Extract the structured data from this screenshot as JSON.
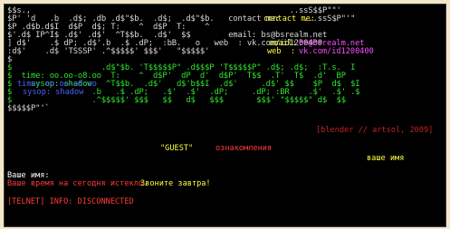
{
  "art": [
    {
      "color": "c-white",
      "text": "$$s.,                                                       ..ssS$$P\"\"'"
    },
    {
      "color": "c-white",
      "text": "$P' 'd   .b  .d$; .db .d$\"$b.  .d$;  .d$\"$b.   contact me:     ...ssS$P\"'\""
    },
    {
      "color": "c-white",
      "text": "$P .d$b.d$I  d$P  d$; T:    ^  d$P  T:    ^"
    },
    {
      "color": "c-white",
      "text": "$'.d$ IP^I$ .d$' .d$'  ^T$$b.  .d$'  $$        email: bs@bsrealm.net"
    },
    {
      "color": "c-white",
      "text": "] d$'    .$ dP; .d$'.b  .$ .dP;  :bB.   o   web  : vk.com/id1200400"
    },
    {
      "color": "c-white",
      "text": ":d$'    .d$ 'TSSSP' .^$$$$$' $$$'   \"$$$$$'"
    },
    {
      "color": "c-white",
      "text": "$"
    },
    {
      "color": "c-green",
      "text": "$                   .d$\"$b. 'T$$$$$P\" .d$$$P 'T$$$$$P\" .d$; .d$;  :T.s.  I"
    },
    {
      "color": "c-green",
      "text": "$  time: oo.oo-o8.oo  T:    ^  d$P'  dP  d'  d$P'  T$$  .T'  T$  .d'  BP"
    },
    {
      "color": "c-green",
      "text": "$    sysop: shadow   ^T$$b.  .d$'   d$'b$$I  .d$'     .d$' $$    $P  d$  $I"
    },
    {
      "color": "c-green",
      "text": "$                 .b   .$ .dP;   .$'  .$'  .dP;     .dP; :BR    .$'  .$' .$"
    },
    {
      "color": "c-green",
      "text": "$                 .^$$$$$' $$$   $$   d$   $$$       $$$' \"$$$$$\" d$  $$"
    },
    {
      "color": "c-white",
      "text": "$$$$$P\"'`"
    }
  ],
  "contact_label": "contact me:",
  "email_label": "email:",
  "email_value": "bs@bsrealm.net",
  "web_label": "web  :",
  "web_value": "vk.com/id1200400",
  "time_text": "time: oo.oo-o8.oo",
  "sysop_text": "sysop: shadow",
  "credit": "[blender // artsol, 2009]",
  "guest_label": "\"GUEST\"",
  "guest_desc": "ознакомления",
  "your_name_hint": "ваше имя",
  "name_prompt": "Ваше имя:",
  "time_expired": "Ваше время на сегодня истекло.",
  "call_tomorrow": "Звоните завтра!",
  "telnet_status": "[TELNET] INFO: DISCONNECTED"
}
